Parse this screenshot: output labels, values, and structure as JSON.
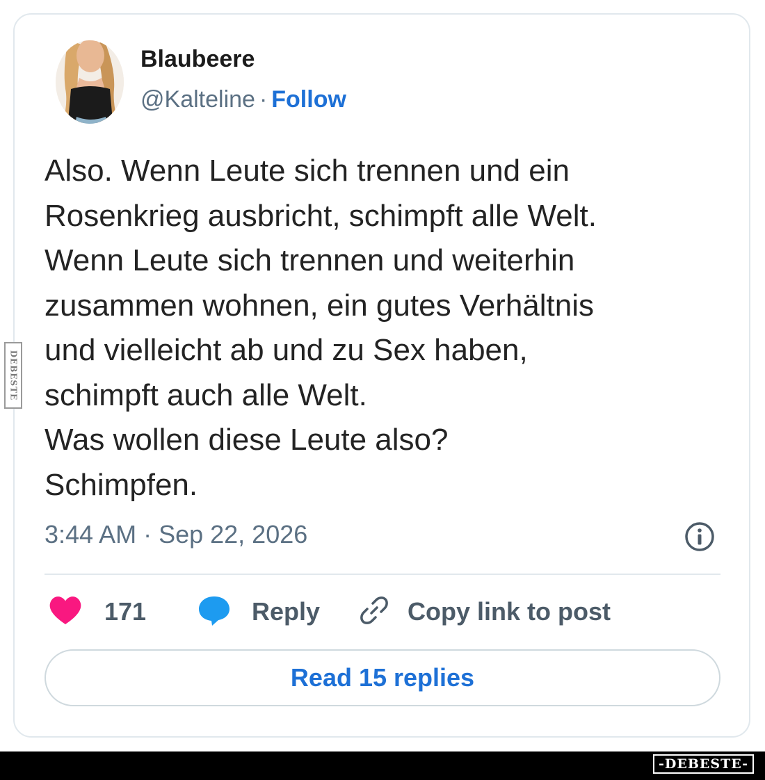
{
  "author": {
    "name": "Blaubeere",
    "handle": "@Kalteline",
    "separator": "·",
    "follow_label": "Follow"
  },
  "tweet": {
    "lines": [
      "Also. Wenn Leute sich trennen und ein",
      "Rosenkrieg ausbricht, schimpft alle Welt.",
      "Wenn Leute sich trennen und weiterhin",
      "zusammen wohnen, ein gutes Verhältnis",
      "und vielleicht ab und zu Sex haben,",
      "schimpft auch alle Welt.",
      "Was wollen diese Leute also?",
      "Schimpfen."
    ],
    "timestamp": "3:44 AM · Sep 22, 2026"
  },
  "actions": {
    "likes_count": "171",
    "reply_label": "Reply",
    "copy_link_label": "Copy link to post",
    "read_replies_label": "Read 15 replies"
  },
  "watermark": {
    "side_text": "DEBESTE",
    "bottom_text": "-DEBESTE-"
  },
  "icons": {
    "like": "heart-icon",
    "reply": "speech-bubble-icon",
    "copy": "link-icon",
    "info": "info-icon"
  },
  "colors": {
    "accent_blue": "#1d70d6",
    "heart": "#f91880",
    "reply_bubble": "#1d9bf0",
    "muted_text": "#5b7083",
    "border": "#e1e8ed"
  }
}
